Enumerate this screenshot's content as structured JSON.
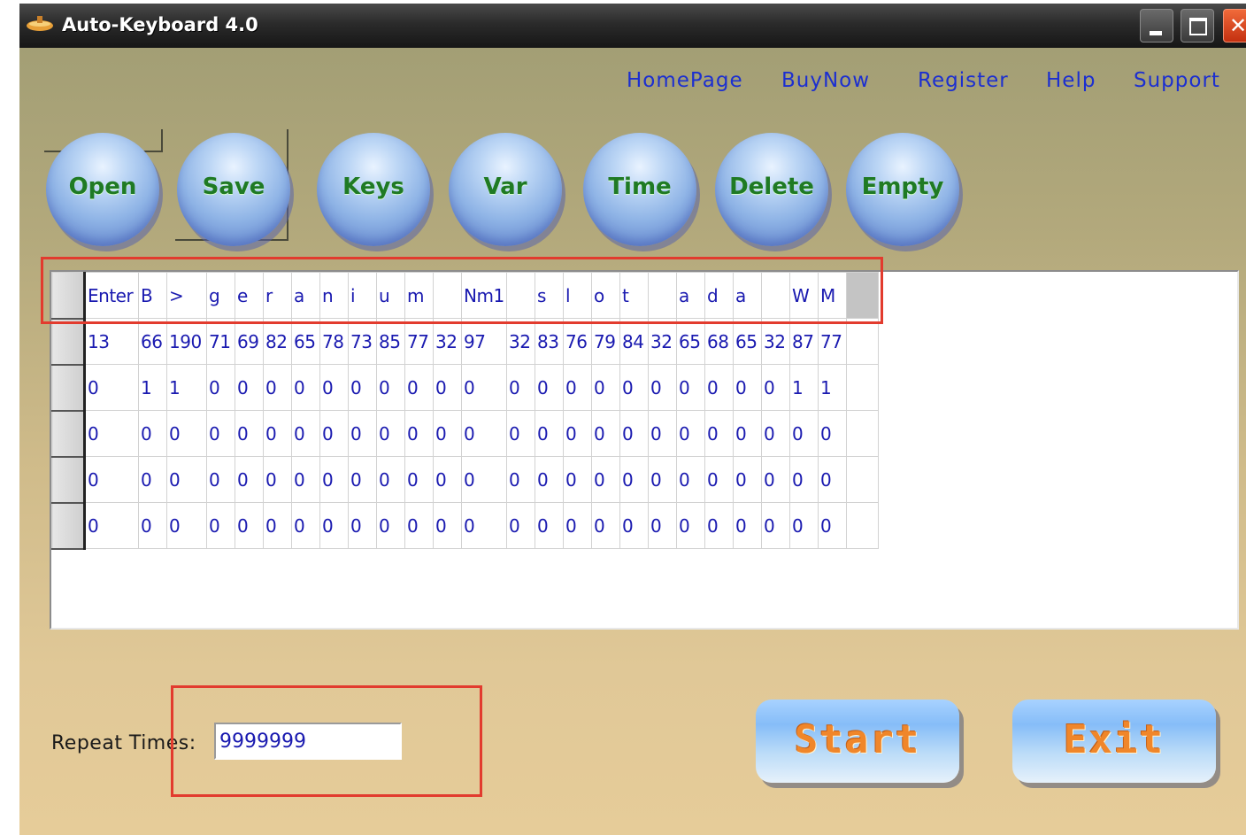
{
  "window": {
    "title": "Auto-Keyboard 4.0",
    "icon": "app-bowl-icon",
    "controls": [
      "minimize-icon",
      "maximize-icon",
      "close-icon"
    ]
  },
  "top_links": [
    "HomePage",
    "BuyNow",
    "Register",
    "Help",
    "Support"
  ],
  "toolbar_buttons": [
    "Open",
    "Save",
    "Keys",
    "Var",
    "Time",
    "Delete",
    "Empty"
  ],
  "grid": {
    "rows": [
      [
        "Enter",
        "B",
        ">",
        "g",
        "e",
        "r",
        "a",
        "n",
        "i",
        "u",
        "m",
        "",
        "Nm1",
        "",
        "s",
        "l",
        "o",
        "t",
        "",
        "a",
        "d",
        "a",
        "",
        "W",
        "M",
        ""
      ],
      [
        "13",
        "66",
        "190",
        "71",
        "69",
        "82",
        "65",
        "78",
        "73",
        "85",
        "77",
        "32",
        "97",
        "32",
        "83",
        "76",
        "79",
        "84",
        "32",
        "65",
        "68",
        "65",
        "32",
        "87",
        "77",
        ""
      ],
      [
        "0",
        "1",
        "1",
        "0",
        "0",
        "0",
        "0",
        "0",
        "0",
        "0",
        "0",
        "0",
        "0",
        "0",
        "0",
        "0",
        "0",
        "0",
        "0",
        "0",
        "0",
        "0",
        "0",
        "1",
        "1",
        ""
      ],
      [
        "0",
        "0",
        "0",
        "0",
        "0",
        "0",
        "0",
        "0",
        "0",
        "0",
        "0",
        "0",
        "0",
        "0",
        "0",
        "0",
        "0",
        "0",
        "0",
        "0",
        "0",
        "0",
        "0",
        "0",
        "0",
        ""
      ],
      [
        "0",
        "0",
        "0",
        "0",
        "0",
        "0",
        "0",
        "0",
        "0",
        "0",
        "0",
        "0",
        "0",
        "0",
        "0",
        "0",
        "0",
        "0",
        "0",
        "0",
        "0",
        "0",
        "0",
        "0",
        "0",
        ""
      ],
      [
        "0",
        "0",
        "0",
        "0",
        "0",
        "0",
        "0",
        "0",
        "0",
        "0",
        "0",
        "0",
        "0",
        "0",
        "0",
        "0",
        "0",
        "0",
        "0",
        "0",
        "0",
        "0",
        "0",
        "0",
        "0",
        ""
      ]
    ]
  },
  "repeat": {
    "label": "Repeat Times:",
    "value": "9999999"
  },
  "actions": {
    "start_label": "Start",
    "exit_label": "Exit"
  },
  "colors": {
    "link": "#1c2fd0",
    "round_button_text": "#1f7a24",
    "grid_text": "#1a1ab0",
    "action_text": "#f0862a",
    "highlight_box": "#e23b2e"
  }
}
